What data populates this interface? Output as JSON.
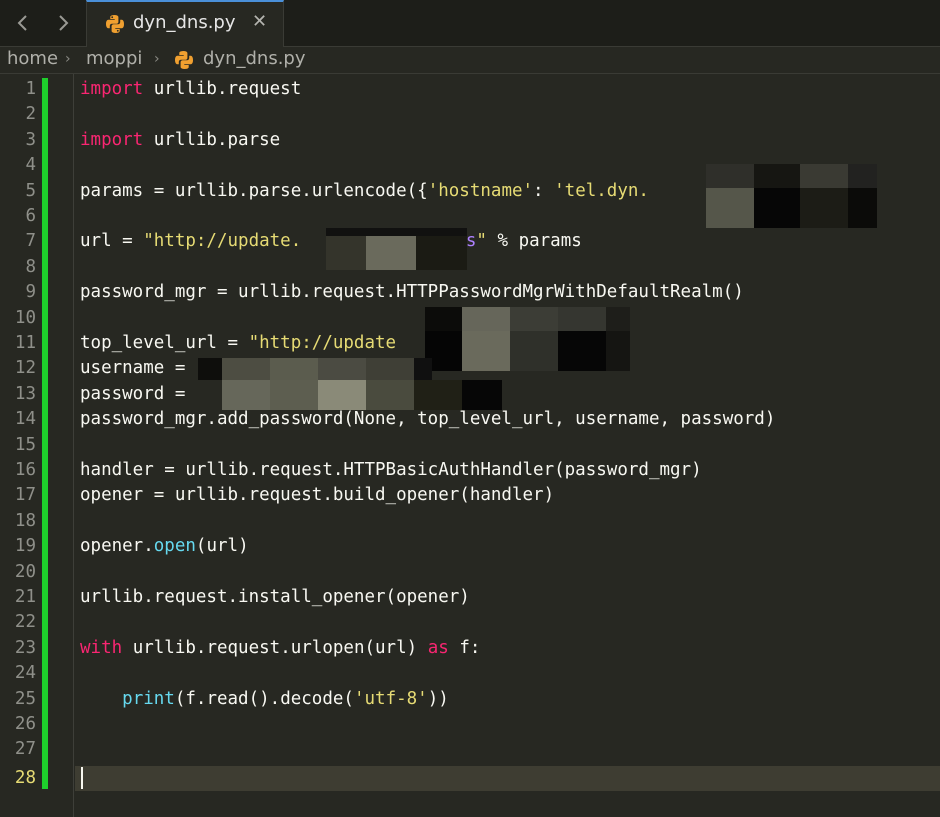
{
  "toolbar": {
    "back_label": "‹",
    "forward_label": "›"
  },
  "tab": {
    "title": "dyn_dns.py",
    "close_glyph": "✕",
    "icon": "python-icon"
  },
  "breadcrumb": {
    "items": [
      "home",
      "moppi",
      "dyn_dns.py"
    ],
    "separator": "›"
  },
  "editor": {
    "current_line": 28,
    "line_numbers": [
      "1",
      "2",
      "3",
      "4",
      "5",
      "6",
      "7",
      "8",
      "9",
      "10",
      "11",
      "12",
      "13",
      "14",
      "15",
      "16",
      "17",
      "18",
      "19",
      "20",
      "21",
      "22",
      "23",
      "24",
      "25",
      "26",
      "27",
      "28"
    ],
    "code": {
      "l1_kw": "import",
      "l1_rest": " urllib.request",
      "l3_kw": "import",
      "l3_rest": " urllib.parse",
      "l5_a": "params = urllib.parse.urlencode({",
      "l5_s1": "'hostname'",
      "l5_b": ": ",
      "l5_s2": "'tel.dyn.",
      "l5_c": ")",
      "l7_a": "url = ",
      "l7_s1": "\"http://update.",
      "l7_s2": "/?",
      "l7_f": "%s",
      "l7_s3": "\"",
      "l7_b": " % params",
      "l9": "password_mgr = urllib.request.HTTPPasswordMgrWithDefaultRealm()",
      "l11_a": "top_level_url = ",
      "l11_s": "\"http://update",
      "l12": "username = ",
      "l13": "password = ",
      "l14": "password_mgr.add_password(None, top_level_url, username, password)",
      "l16": "handler = urllib.request.HTTPBasicAuthHandler(password_mgr)",
      "l17": "opener = urllib.request.build_opener(handler)",
      "l19_a": "opener.",
      "l19_fn": "open",
      "l19_b": "(url)",
      "l21": "urllib.request.install_opener(opener)",
      "l23_kw1": "with",
      "l23_a": " urllib.request.urlopen(url) ",
      "l23_kw2": "as",
      "l23_b": " f:",
      "l25_indent": "    ",
      "l25_fn": "print",
      "l25_a": "(f.read().decode(",
      "l25_s": "'utf-8'",
      "l25_b": "))"
    }
  },
  "colors": {
    "keyword": "#f92672",
    "string": "#e6db74",
    "builtin": "#66d9ef",
    "format": "#ae81ff",
    "change_bar": "#1ecf2c",
    "background": "#272822"
  }
}
